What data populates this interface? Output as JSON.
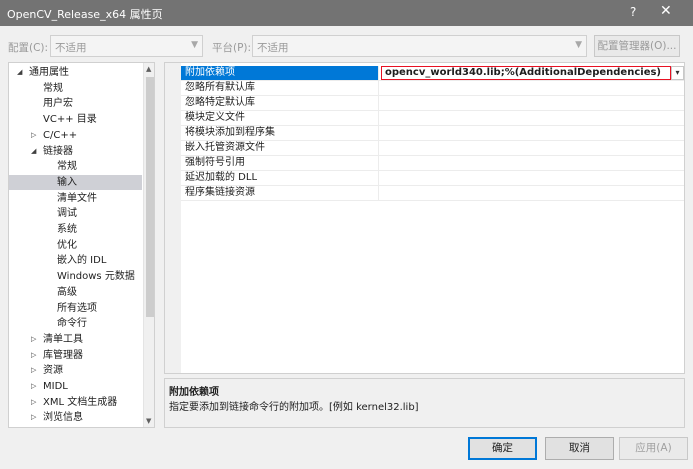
{
  "window": {
    "title": "OpenCV_Release_x64 属性页",
    "help": "?",
    "close": "✕"
  },
  "toolbar": {
    "config_label": "配置(C):",
    "config_value": "不适用",
    "platform_label": "平台(P):",
    "platform_value": "不适用",
    "config_manager": "配置管理器(O)..."
  },
  "tree": {
    "items": [
      {
        "label": "通用属性",
        "level": 0,
        "expander": "◢"
      },
      {
        "label": "常规",
        "level": 1
      },
      {
        "label": "用户宏",
        "level": 1
      },
      {
        "label": "VC++ 目录",
        "level": 1
      },
      {
        "label": "C/C++",
        "level": 1,
        "expander": "▷"
      },
      {
        "label": "链接器",
        "level": 1,
        "expander": "◢"
      },
      {
        "label": "常规",
        "level": 2
      },
      {
        "label": "输入",
        "level": 2,
        "selected": true
      },
      {
        "label": "清单文件",
        "level": 2
      },
      {
        "label": "调试",
        "level": 2
      },
      {
        "label": "系统",
        "level": 2
      },
      {
        "label": "优化",
        "level": 2
      },
      {
        "label": "嵌入的 IDL",
        "level": 2
      },
      {
        "label": "Windows 元数据",
        "level": 2
      },
      {
        "label": "高级",
        "level": 2
      },
      {
        "label": "所有选项",
        "level": 2
      },
      {
        "label": "命令行",
        "level": 2
      },
      {
        "label": "清单工具",
        "level": 1,
        "expander": "▷"
      },
      {
        "label": "库管理器",
        "level": 1,
        "expander": "▷"
      },
      {
        "label": "资源",
        "level": 1,
        "expander": "▷"
      },
      {
        "label": "MIDL",
        "level": 1,
        "expander": "▷"
      },
      {
        "label": "XML 文档生成器",
        "level": 1,
        "expander": "▷"
      },
      {
        "label": "浏览信息",
        "level": 1,
        "expander": "▷"
      }
    ]
  },
  "properties": {
    "rows": [
      {
        "name": "附加依赖项",
        "value": "opencv_world340.lib;%(AdditionalDependencies)",
        "selected": true
      },
      {
        "name": "忽略所有默认库",
        "value": ""
      },
      {
        "name": "忽略特定默认库",
        "value": ""
      },
      {
        "name": "模块定义文件",
        "value": ""
      },
      {
        "name": "将模块添加到程序集",
        "value": ""
      },
      {
        "name": "嵌入托管资源文件",
        "value": ""
      },
      {
        "name": "强制符号引用",
        "value": ""
      },
      {
        "name": "延迟加载的 DLL",
        "value": ""
      },
      {
        "name": "程序集链接资源",
        "value": ""
      }
    ]
  },
  "description": {
    "title": "附加依赖项",
    "text": "指定要添加到链接命令行的附加项。[例如 kernel32.lib]"
  },
  "buttons": {
    "ok": "确定",
    "cancel": "取消",
    "apply": "应用(A)"
  },
  "colors": {
    "titlebar": "#737373",
    "selection": "#0078d7",
    "tree_selection": "#cfd0d6",
    "value_border": "#e81123"
  }
}
